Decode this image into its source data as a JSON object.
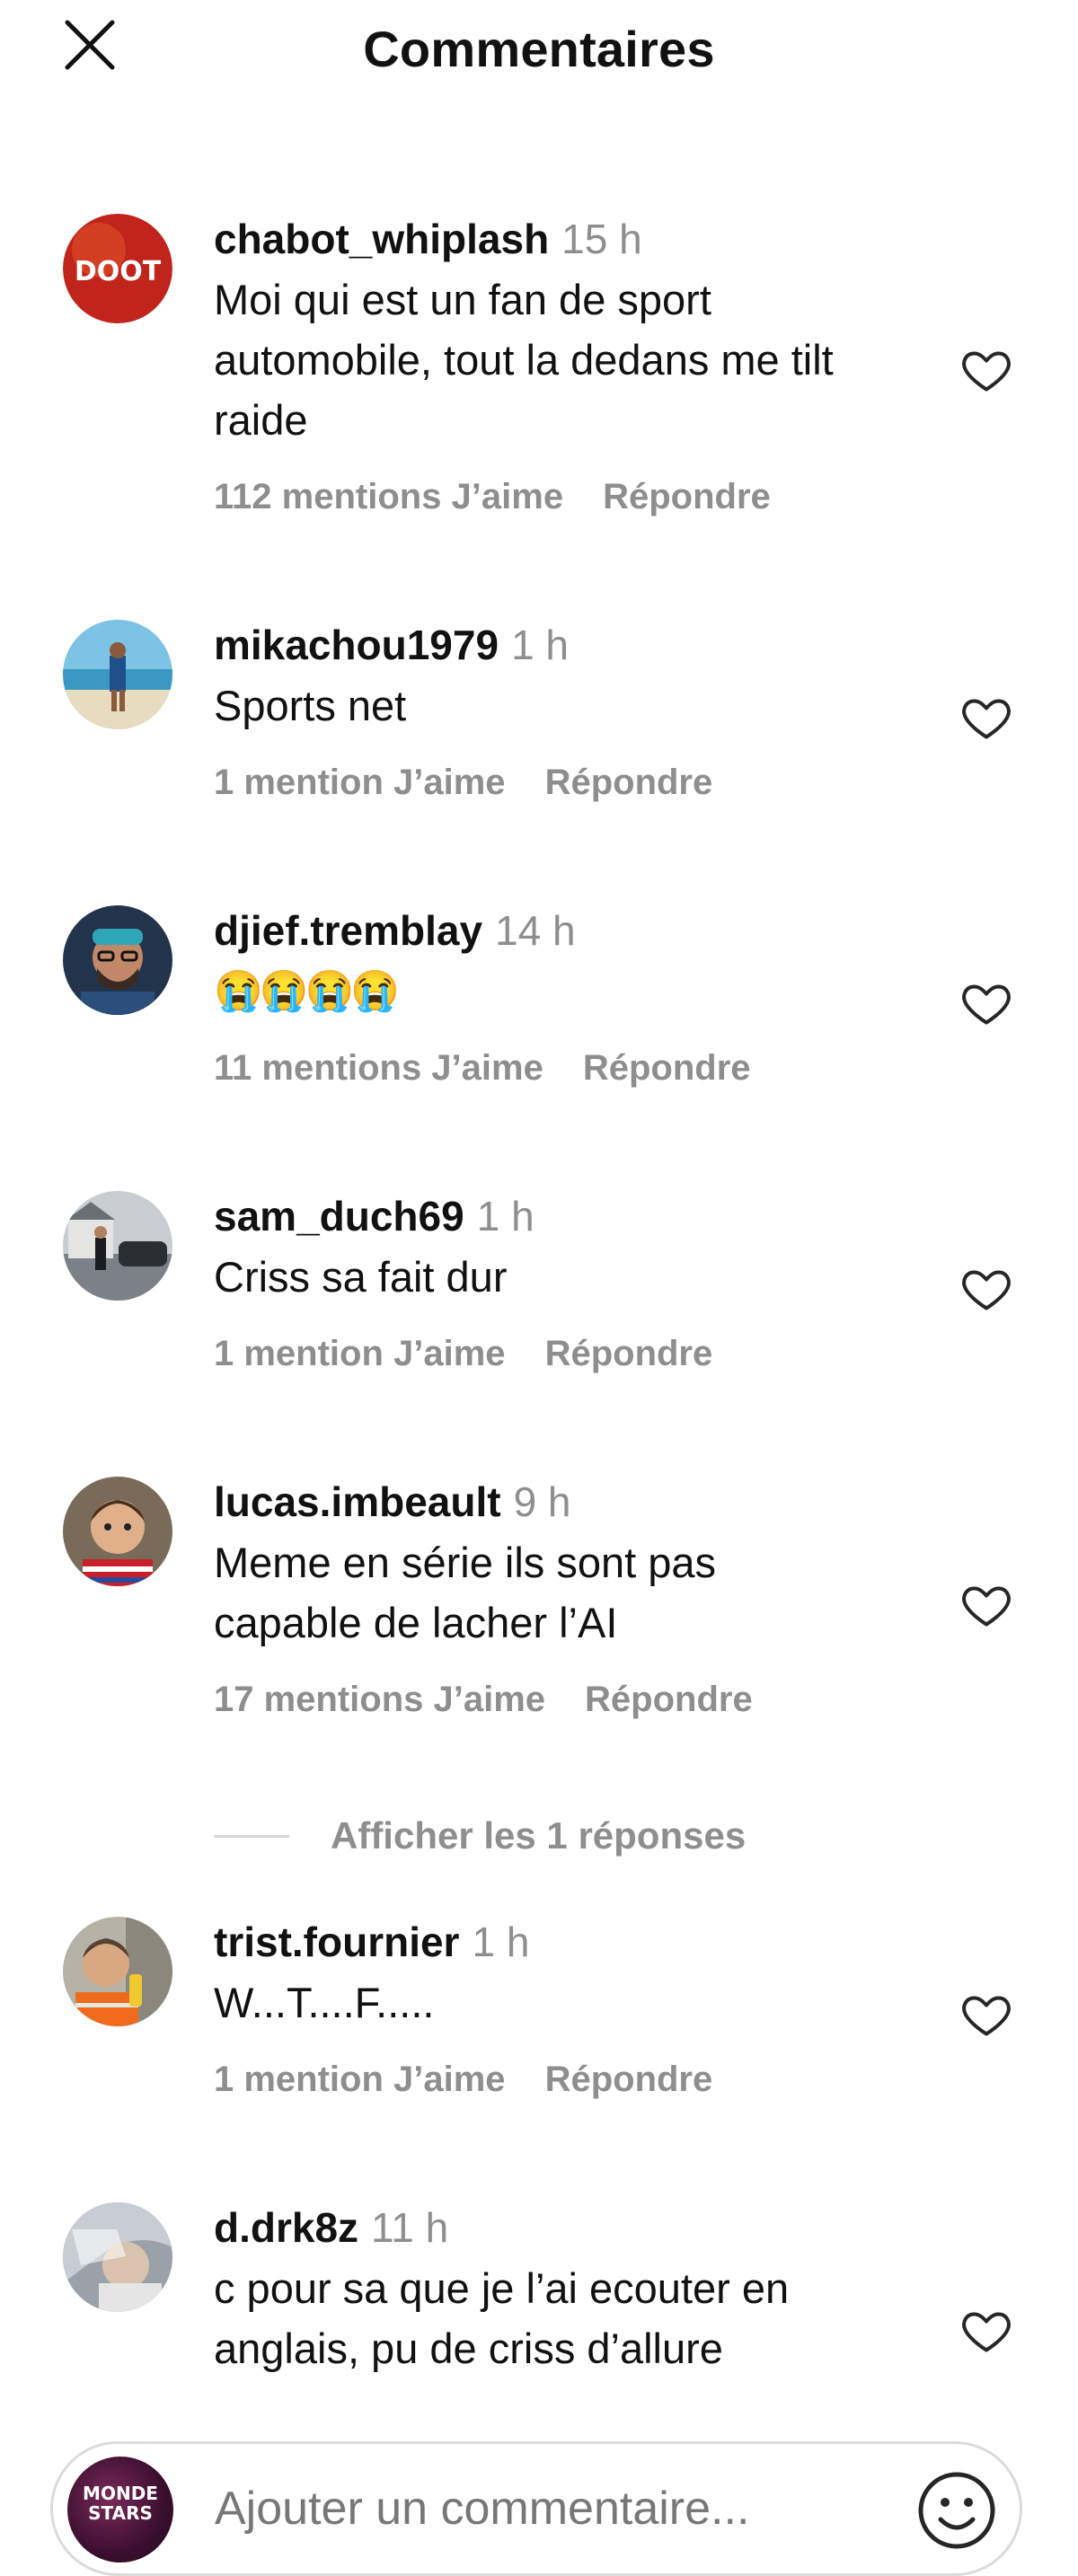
{
  "header": {
    "title": "Commentaires",
    "close_icon": "close-icon"
  },
  "comments": [
    {
      "username": "chabot_whiplash",
      "time": "15 h",
      "text": "Moi qui est un fan de sport automobile, tout la dedans me tilt raide",
      "likes": "112 mentions J’aime",
      "reply": "Répondre",
      "avatar_label": "DOOT",
      "avatar_color": "#c0241b"
    },
    {
      "username": "mikachou1979",
      "time": "1 h",
      "text": "Sports net",
      "likes": "1 mention J’aime",
      "reply": "Répondre",
      "avatar_color": "#6fb6d8"
    },
    {
      "username": "djief.tremblay",
      "time": "14 h",
      "text": "😭😭😭😭",
      "likes": "11 mentions J’aime",
      "reply": "Répondre",
      "avatar_color": "#2b3d55"
    },
    {
      "username": "sam_duch69",
      "time": "1 h",
      "text": "Criss sa fait dur",
      "likes": "1 mention J’aime",
      "reply": "Répondre",
      "avatar_color": "#8a9095"
    },
    {
      "username": "lucas.imbeault",
      "time": "9 h",
      "text": "Meme en série ils sont pas capable de lacher l’AI",
      "likes": "17 mentions J’aime",
      "reply": "Répondre",
      "avatar_color": "#b58a5e"
    },
    {
      "username": "trist.fournier",
      "time": "1 h",
      "text": "W...T....F.....",
      "likes": "1 mention J’aime",
      "reply": "Répondre",
      "avatar_color": "#a9a39a"
    },
    {
      "username": "d.drk8z",
      "time": "11 h",
      "text": "c pour sa que je l’ai ecouter en anglais, pu de criss d’allure",
      "likes": "",
      "reply": "",
      "avatar_color": "#9aa1a8"
    }
  ],
  "view_replies": {
    "label": "Afficher les 1 réponses"
  },
  "composer": {
    "placeholder": "Ajouter un commentaire...",
    "avatar_label": "MONDE STARS",
    "emoji_icon": "emoji-icon"
  },
  "colors": {
    "secondary_text": "#8e8e8e",
    "heart_stroke": "#262626",
    "border": "#dbdbdb"
  }
}
